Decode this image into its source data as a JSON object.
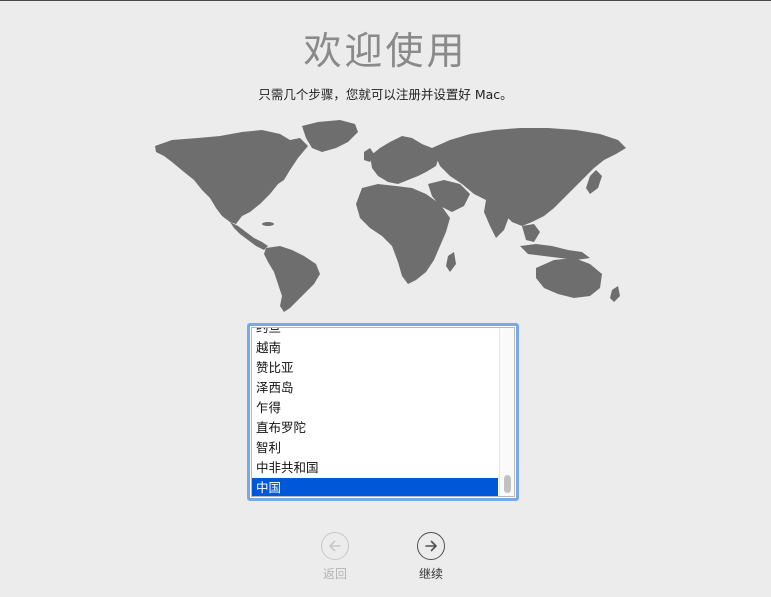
{
  "header": {
    "title": "欢迎使用",
    "subtitle": "只需几个步骤，您就可以注册并设置好 Mac。"
  },
  "country_list": {
    "items": [
      "约旦",
      "越南",
      "赞比亚",
      "泽西岛",
      "乍得",
      "直布罗陀",
      "智利",
      "中非共和国",
      "中国"
    ],
    "selected": "中国",
    "selection_color": "#0058d9"
  },
  "navigation": {
    "back_label": "返回",
    "back_icon": "arrow-left-circle-icon",
    "continue_label": "继续",
    "continue_icon": "arrow-right-circle-icon"
  },
  "colors": {
    "background": "#ececec",
    "focus_ring": "#7aa7e6",
    "map_fill": "#6e6e6e"
  }
}
